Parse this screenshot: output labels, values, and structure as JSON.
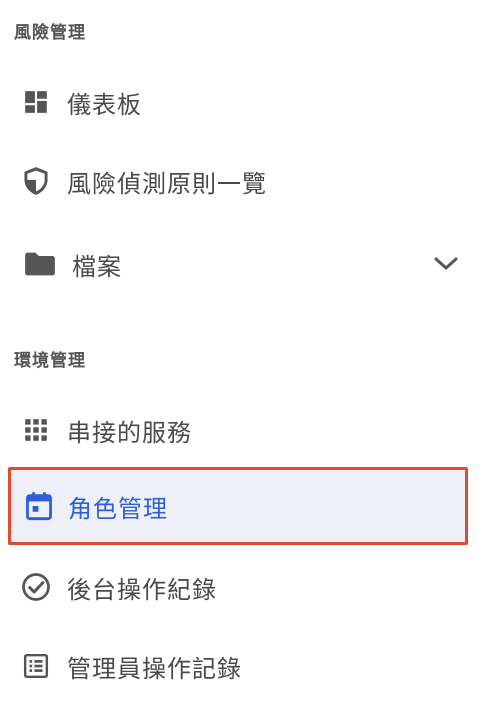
{
  "sections": [
    {
      "title": "風險管理"
    },
    {
      "title": "環境管理"
    }
  ],
  "items": [
    {
      "label": "儀表板",
      "icon": "dashboard-icon"
    },
    {
      "label": "風險偵測原則一覽",
      "icon": "shield-icon"
    },
    {
      "label": "檔案",
      "icon": "folder-icon",
      "expandable": true
    },
    {
      "label": "串接的服務",
      "icon": "apps-grid-icon"
    },
    {
      "label": "角色管理",
      "icon": "calendar-icon",
      "active": true
    },
    {
      "label": "後台操作紀錄",
      "icon": "check-circle-icon"
    },
    {
      "label": "管理員操作記錄",
      "icon": "list-icon"
    }
  ],
  "colors": {
    "text": "#4a4a4a",
    "active_text": "#2b5fd9",
    "active_background": "#eeeff8",
    "highlight_border": "#e04a2f",
    "icon": "#555555"
  }
}
